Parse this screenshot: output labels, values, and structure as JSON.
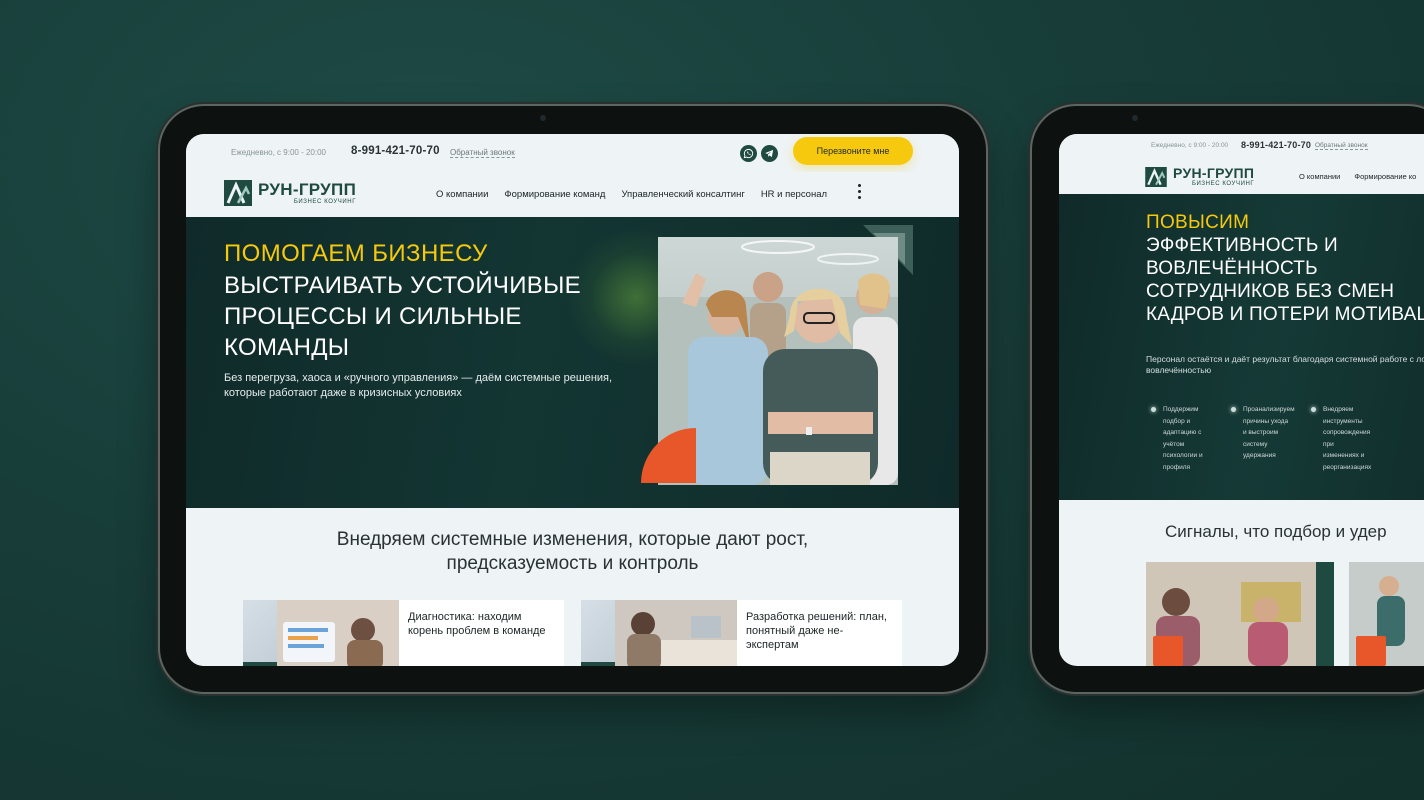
{
  "brand": {
    "name": "РУН-ГРУПП",
    "tagline": "БИЗНЕС КОУЧИНГ",
    "accent_yellow": "#f6c90e",
    "accent_orange": "#e8572a",
    "dark_green": "#1f4a42"
  },
  "topbar": {
    "hours": "Ежедневно, с 9:00 - 20:00",
    "phone": "8-991-421-70-70",
    "callback_link": "Обратный звонок",
    "social_icons": [
      "whatsapp-icon",
      "telegram-icon"
    ],
    "call_me_button": "Перезвоните мне"
  },
  "nav": {
    "items": [
      "О компании",
      "Формирование команд",
      "Управленческий консалтинг",
      "HR и персонал"
    ],
    "more_icon": "more-vertical-icon"
  },
  "hero": {
    "title_highlight": "ПОМОГАЕМ БИЗНЕСУ",
    "title_rest": "ВЫСТРАИВАТЬ УСТОЙЧИВЫЕ ПРОЦЕССЫ И СИЛЬНЫЕ КОМАНДЫ",
    "description": "Без перегруза, хаоса и «ручного управления» — даём системные решения, которые работают даже в кризисных условиях"
  },
  "section": {
    "title_line1": "Внедряем системные изменения, которые дают рост,",
    "title_line2": "предсказуемость и контроль",
    "cards": [
      {
        "title": "Диагностика: находим корень проблем в команде"
      },
      {
        "title": "Разработка решений: план, понятный даже не-экспертам"
      }
    ]
  },
  "page2": {
    "nav": {
      "items": [
        "О компании",
        "Формирование ко"
      ]
    },
    "hero": {
      "title_highlight": "ПОВЫСИМ",
      "title_rest": "ЭФФЕКТИВНОСТЬ И ВОВЛЕЧЁННОСТЬ СОТРУДНИКОВ БЕЗ СМЕН КАДРОВ И ПОТЕРИ МОТИВАЦИИ",
      "description": "Персонал остаётся и даёт результат благодаря системной работе с лояльностью и вовлечённостью",
      "bullets": [
        "Поддержим подбор и адаптацию с учётом психологии и профиля",
        "Проанализируем причины ухода и выстроим систему удержания",
        "Внедряем инструменты сопровождения при изменениях и реорганизациях"
      ]
    },
    "section_title": "Сигналы, что подбор и удер"
  }
}
